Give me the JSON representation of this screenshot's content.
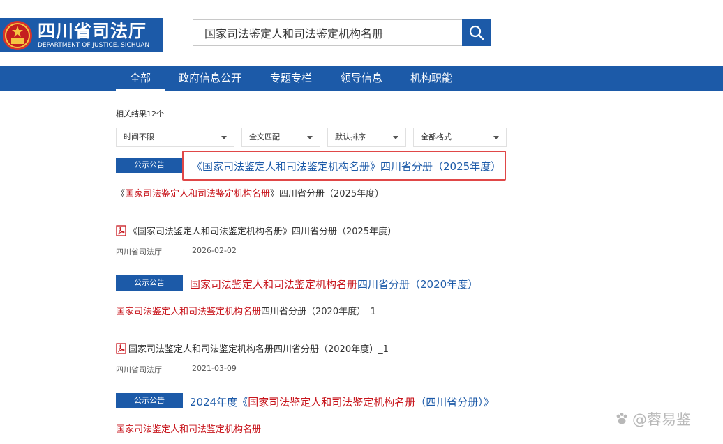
{
  "header": {
    "logo_cn": "四川省司法厅",
    "logo_en": "DEPARTMENT OF JUSTICE, SICHUAN",
    "search_value": "国家司法鉴定人和司法鉴定机构名册",
    "search_icon": "search-icon"
  },
  "nav": {
    "items": [
      "全部",
      "政府信息公开",
      "专题专栏",
      "领导信息",
      "机构职能"
    ],
    "active": "全部"
  },
  "results": {
    "count_label": "相关结果12个",
    "filters": [
      "时间不限",
      "全文匹配",
      "默认排序",
      "全部格式"
    ],
    "items": [
      {
        "tag": "公示公告",
        "title": "《国家司法鉴定人和司法鉴定机构名册》四川省分册（2025年度）",
        "snippet_pre": "《",
        "snippet_red": "国家司法鉴定人和司法鉴定机构名册",
        "snippet_post": "》四川省分册（2025年度）",
        "attachment": "《国家司法鉴定人和司法鉴定机构名册》四川省分册（2025年度）",
        "source": "四川省司法厅",
        "date": "2026-02-02"
      },
      {
        "tag": "公示公告",
        "title_red": "国家司法鉴定人和司法鉴定机构名册",
        "title_rest": "四川省分册（2020年度）",
        "snippet_red": "国家司法鉴定人和司法鉴定机构名册",
        "snippet_post": "四川省分册（2020年度）_1",
        "attachment": "国家司法鉴定人和司法鉴定机构名册四川省分册（2020年度）_1",
        "source": "四川省司法厅",
        "date": "2021-03-09"
      },
      {
        "tag": "公示公告",
        "title_pre": "2024年度《",
        "title_red": "国家司法鉴定人和司法鉴定机构名册",
        "title_post": "（四川省分册）》",
        "snippet_red": "国家司法鉴定人和司法鉴定机构名册"
      }
    ]
  },
  "watermark": "@蓉易鉴",
  "colors": {
    "brand_blue": "#1c5aa8",
    "keyword_red": "#c8161d",
    "highlight_border": "#e04747"
  }
}
